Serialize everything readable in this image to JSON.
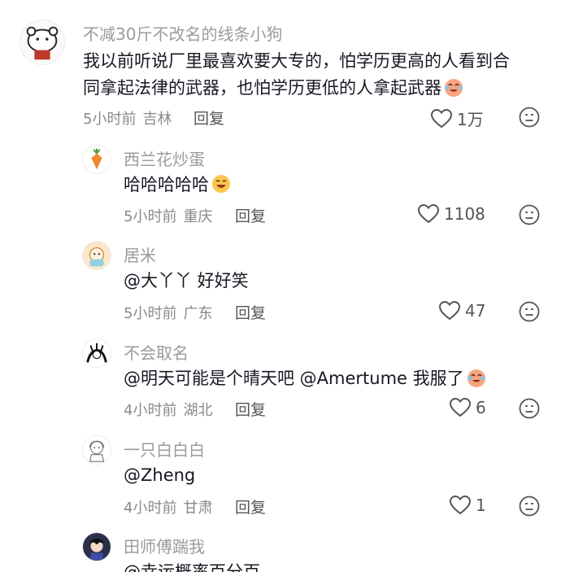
{
  "comments": [
    {
      "username": "不减30斤不改名的线条小狗",
      "lines": [
        "我以前听说厂里最喜欢要大专的，怕学历更高的人看到合",
        "同拿起法律的武器，也怕学历更低的人拿起武器"
      ],
      "time": "5小时前",
      "location": "吉林",
      "reply": "回复",
      "likes": "1万"
    },
    {
      "username": "西兰花炒蛋",
      "lines": [
        "哈哈哈哈哈"
      ],
      "time": "5小时前",
      "location": "重庆",
      "reply": "回复",
      "likes": "1108"
    },
    {
      "username": "居米",
      "lines": [
        "@大丫丫 好好笑"
      ],
      "time": "5小时前",
      "location": "广东",
      "reply": "回复",
      "likes": "47"
    },
    {
      "username": "不会取名",
      "lines": [
        "@明天可能是个晴天吧 @Amertume 我服了"
      ],
      "time": "4小时前",
      "location": "湖北",
      "reply": "回复",
      "likes": "6"
    },
    {
      "username": "一只白白白",
      "lines": [
        "@Zheng"
      ],
      "time": "4小时前",
      "location": "甘肃",
      "reply": "回复",
      "likes": "1"
    },
    {
      "username": "田师傅踹我",
      "lines": [
        "@幸运概率百分百"
      ]
    }
  ],
  "icons": {
    "like": "heart-outline-icon",
    "dislike": "unhappy-face-icon",
    "emoji_1": "laughing-crying-emoji",
    "emoji_2": "grinning-emoji"
  }
}
